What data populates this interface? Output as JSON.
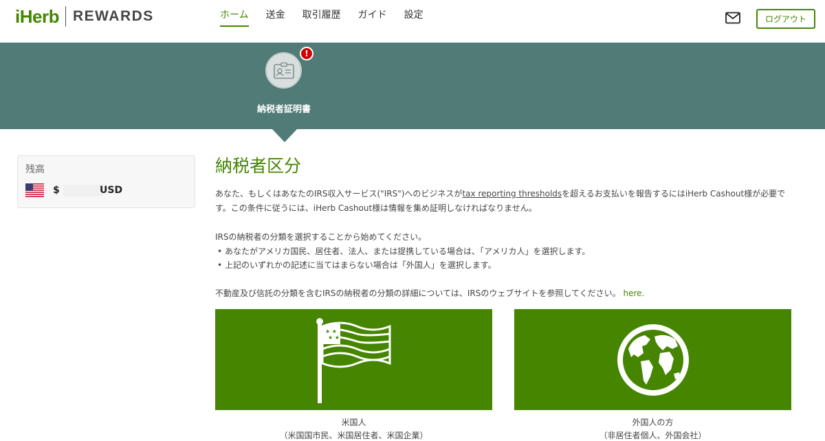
{
  "brand": {
    "logo_main": "iHerb",
    "logo_sub": "REWARDS",
    "accent_color": "#458500",
    "banner_color": "#517b76"
  },
  "nav": {
    "items": [
      {
        "label": "ホーム",
        "active": true
      },
      {
        "label": "送金",
        "active": false
      },
      {
        "label": "取引履歴",
        "active": false
      },
      {
        "label": "ガイド",
        "active": false
      },
      {
        "label": "設定",
        "active": false
      }
    ]
  },
  "header": {
    "mail_icon": "envelope-icon",
    "logout_label": "ログアウト"
  },
  "banner": {
    "step_icon": "id-card-icon",
    "alert_mark": "!",
    "step_label": "納税者証明書"
  },
  "balance": {
    "title": "残高",
    "flag_icon": "us-flag-icon",
    "dollar_sign": "$",
    "currency": "USD"
  },
  "main": {
    "title": "納税者区分",
    "intro_before_link": "あなた、もしくはあなたのIRS収入サービス(\"IRS\")へのビジネスが",
    "intro_link": "tax reporting thresholds",
    "intro_after_link": "を超えるお支払いを報告するにはiHerb Cashout様が必要です。この条件に従うには、iHerb Cashout様は情報を集め証明しなければなりません。",
    "start_text": "IRSの納税者の分類を選択することから始めてください。",
    "bullets": [
      "あなたがアメリカ国民、居住者、法人、または提携している場合は、「アメリカ人」を選択します。",
      "上記のいずれかの記述に当てはまらない場合は「外国人」を選択します。"
    ],
    "details_text": "不動産及び信託の分類を含むIRSの納税者の分類の詳細については、IRSのウェブサイトを参照してください。",
    "details_link": "here."
  },
  "options": {
    "us": {
      "icon": "us-flag-icon",
      "title": "米国人",
      "subtitle": "（米国国市民、米国居住者、米国企業）"
    },
    "foreign": {
      "icon": "globe-icon",
      "title": "外国人の方",
      "subtitle": "（非居住者個人、外国会社）"
    }
  }
}
